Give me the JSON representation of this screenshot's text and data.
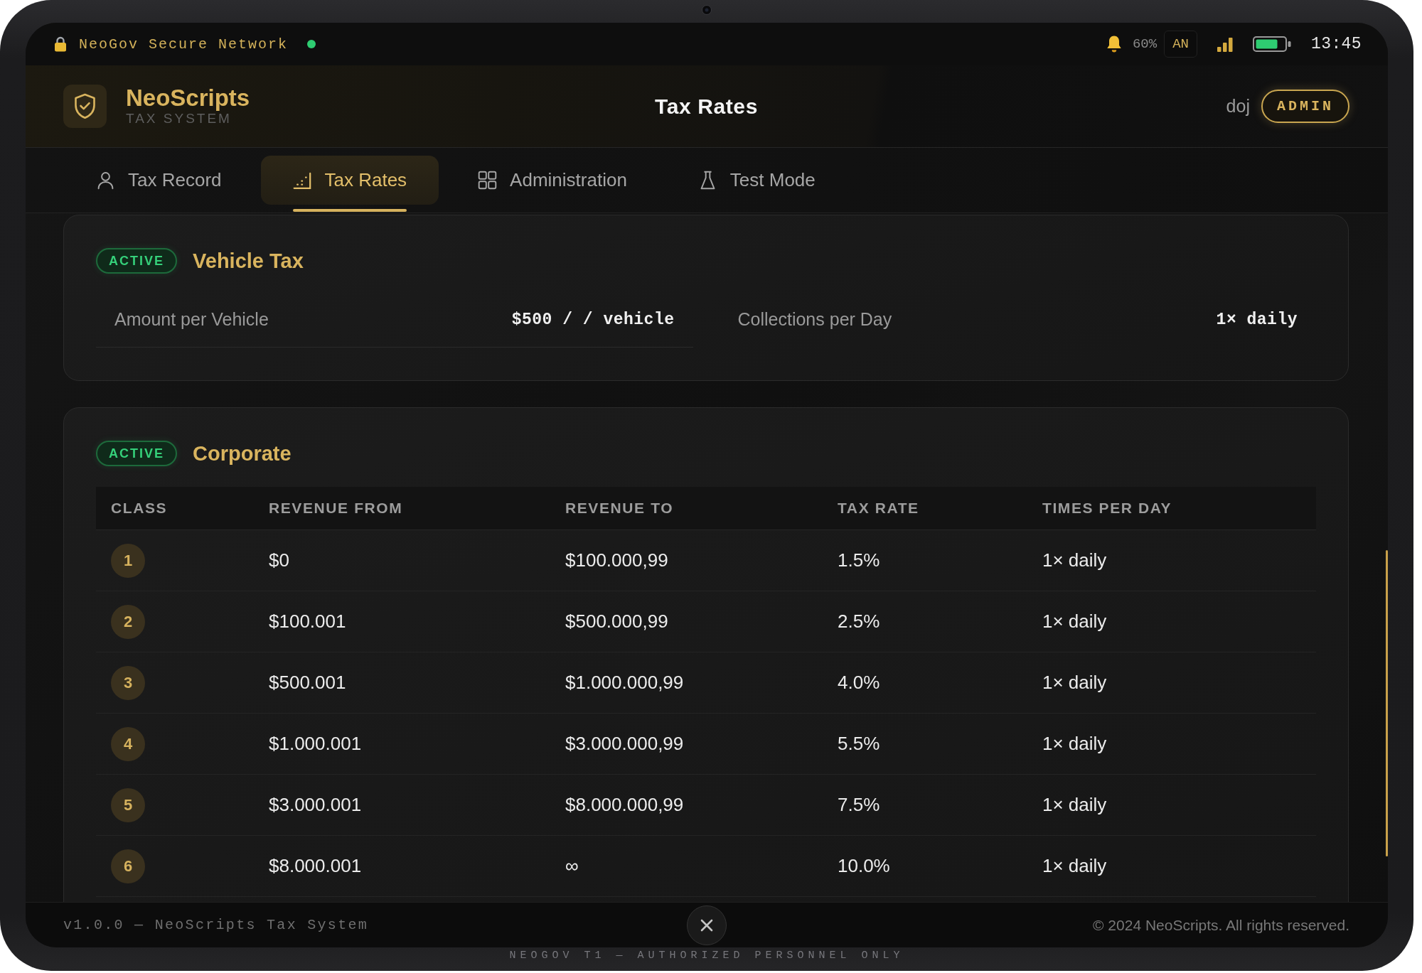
{
  "device": {
    "caption": "NEOGOV T1 — AUTHORIZED PERSONNEL ONLY"
  },
  "status_bar": {
    "network": "NeoGov Secure Network",
    "online": true,
    "percent": "60%",
    "tag": "AN",
    "time": "13:45"
  },
  "header": {
    "brand": "NeoScripts",
    "subtitle": "TAX SYSTEM",
    "title": "Tax Rates",
    "user": "doj",
    "role": "ADMIN"
  },
  "tabs": [
    {
      "label": "Tax Record",
      "selected": false
    },
    {
      "label": "Tax Rates",
      "selected": true
    },
    {
      "label": "Administration",
      "selected": false
    },
    {
      "label": "Test Mode",
      "selected": false
    }
  ],
  "taxes": [
    {
      "kind": "fields",
      "status": "ACTIVE",
      "active": true,
      "name": "Vehicle Tax",
      "fields": [
        {
          "label": "Amount per Vehicle",
          "value": "$500 / / vehicle"
        },
        {
          "label": "Collections per Day",
          "value": "1× daily"
        }
      ]
    },
    {
      "kind": "table",
      "status": "ACTIVE",
      "active": true,
      "name": "Corporate",
      "columns": [
        "CLASS",
        "REVENUE FROM",
        "REVENUE TO",
        "TAX RATE",
        "TIMES PER DAY"
      ],
      "rows": [
        [
          "1",
          "$0",
          "$100.000,99",
          "1.5%",
          "1× daily"
        ],
        [
          "2",
          "$100.001",
          "$500.000,99",
          "2.5%",
          "1× daily"
        ],
        [
          "3",
          "$500.001",
          "$1.000.000,99",
          "4.0%",
          "1× daily"
        ],
        [
          "4",
          "$1.000.001",
          "$3.000.000,99",
          "5.5%",
          "1× daily"
        ],
        [
          "5",
          "$3.000.001",
          "$8.000.000,99",
          "7.5%",
          "1× daily"
        ],
        [
          "6",
          "$8.000.001",
          "∞",
          "10.0%",
          "1× daily"
        ]
      ]
    }
  ],
  "footer": {
    "version": "v1.0.0 — NeoScripts Tax System",
    "copyright": "© 2024 NeoScripts. All rights reserved."
  }
}
